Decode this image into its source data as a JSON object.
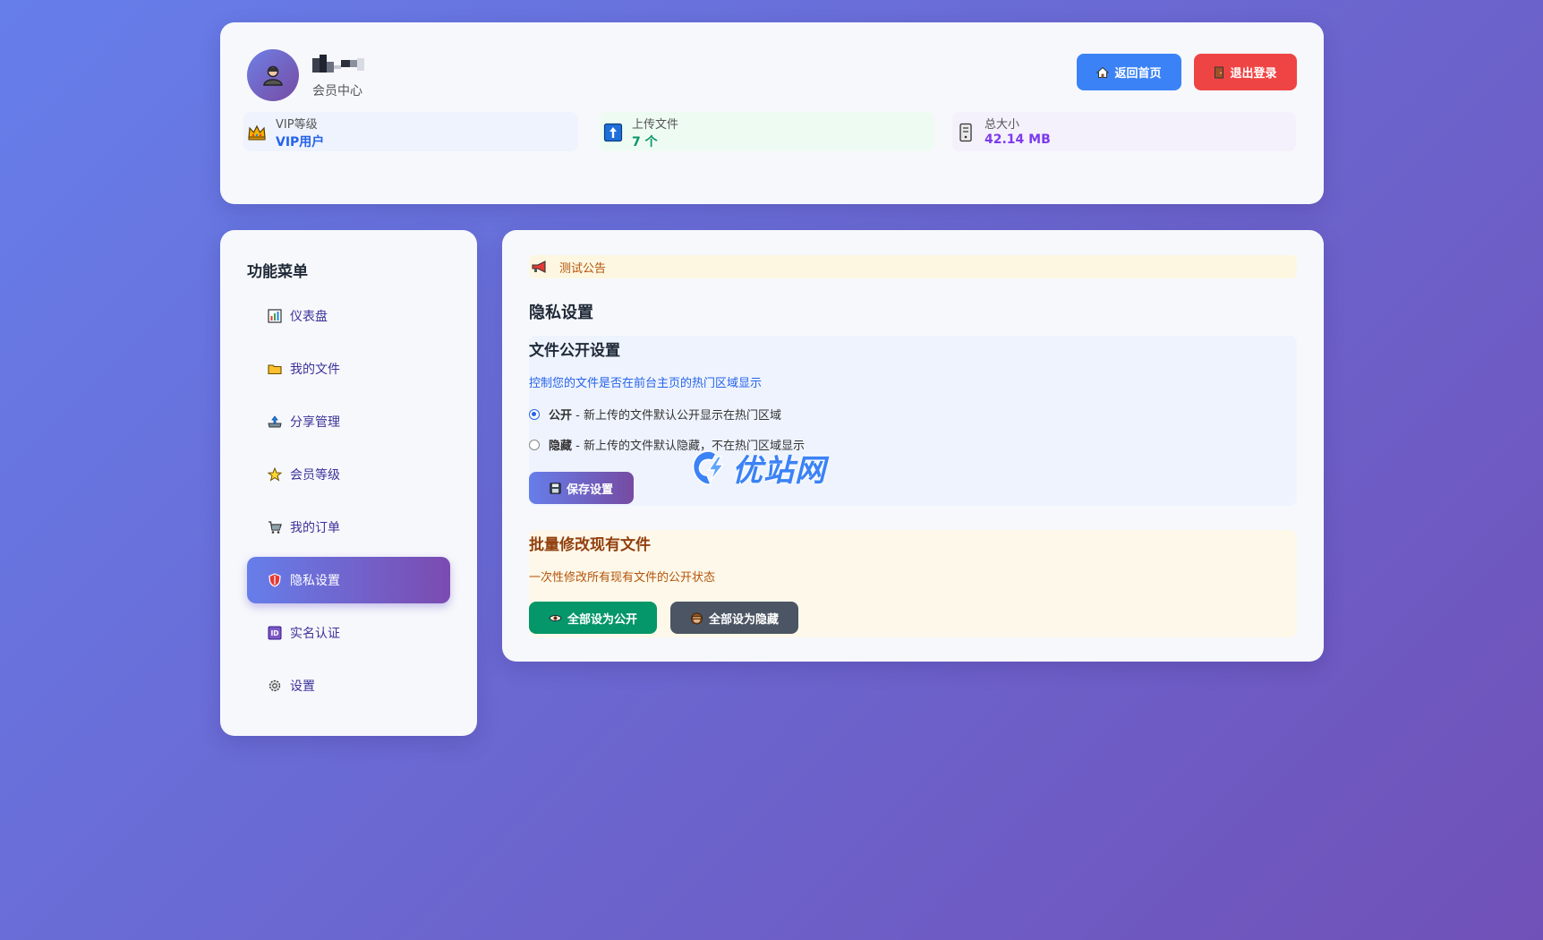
{
  "header": {
    "user_sub": "会员中心",
    "home_button": "返回首页",
    "logout_button": "退出登录",
    "stats": [
      {
        "label": "VIP等级",
        "value": "VIP用户",
        "color": "#2563eb",
        "icon": "crown-icon"
      },
      {
        "label": "上传文件",
        "value": "7 个",
        "color": "#059669",
        "icon": "upload-arrow-icon"
      },
      {
        "label": "总大小",
        "value": "42.14 MB",
        "color": "#7c3aed",
        "icon": "storage-icon"
      }
    ]
  },
  "sidebar": {
    "title": "功能菜单",
    "items": [
      {
        "label": "仪表盘",
        "icon": "chart-icon"
      },
      {
        "label": "我的文件",
        "icon": "folder-icon"
      },
      {
        "label": "分享管理",
        "icon": "share-tray-icon"
      },
      {
        "label": "会员等级",
        "icon": "star-icon"
      },
      {
        "label": "我的订单",
        "icon": "cart-icon"
      },
      {
        "label": "隐私设置",
        "icon": "shield-icon",
        "active": true
      },
      {
        "label": "实名认证",
        "icon": "id-card-icon"
      },
      {
        "label": "设置",
        "icon": "gear-icon"
      }
    ]
  },
  "main": {
    "notice": "测试公告",
    "page_title": "隐私设置",
    "file_public": {
      "title": "文件公开设置",
      "desc": "控制您的文件是否在前台主页的热门区域显示",
      "option_public_bold": "公开",
      "option_public_text": " - 新上传的文件默认公开显示在热门区域",
      "option_hidden_bold": "隐藏",
      "option_hidden_text": " - 新上传的文件默认隐藏，不在热门区域显示",
      "selected": "public",
      "save_button": "保存设置"
    },
    "batch": {
      "title": "批量修改现有文件",
      "desc": "一次性修改所有现有文件的公开状态",
      "public_button": "全部设为公开",
      "hide_button": "全部设为隐藏"
    }
  },
  "watermark": "优站网",
  "colors": {
    "accent": "#667eea",
    "home": "#3b82f6",
    "logout": "#ef4444",
    "save_from": "#667eea",
    "save_to": "#764ba2",
    "public": "#059669",
    "hide": "#4b5563",
    "notice_text": "#b45309",
    "desc_blue": "#2563eb",
    "batch_title": "#92400e"
  }
}
